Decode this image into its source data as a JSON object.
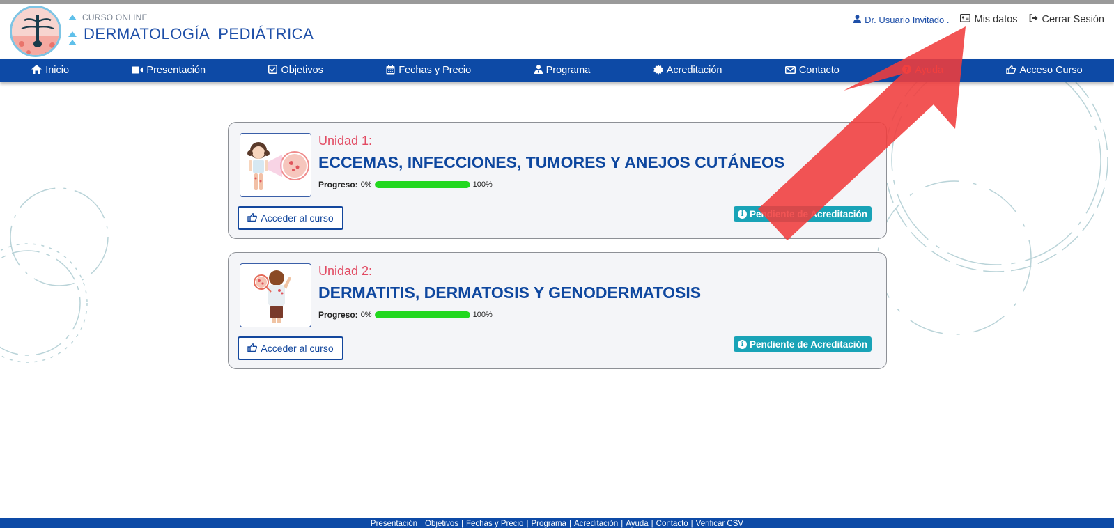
{
  "header": {
    "brand_small": "CURSO ONLINE",
    "brand_big": "DERMATOLOGÍA  PEDIÁTRICA",
    "user_name": "Dr. Usuario Invitado .",
    "my_data": "Mis datos",
    "logout": "Cerrar Sesión"
  },
  "nav": {
    "items": [
      {
        "label": "Inicio",
        "icon": "home-icon"
      },
      {
        "label": "Presentación",
        "icon": "video-icon"
      },
      {
        "label": "Objetivos",
        "icon": "check-square-icon"
      },
      {
        "label": "Fechas y Precio",
        "icon": "calendar-icon"
      },
      {
        "label": "Programa",
        "icon": "user-md-icon"
      },
      {
        "label": "Acreditación",
        "icon": "certificate-icon"
      },
      {
        "label": "Contacto",
        "icon": "envelope-icon"
      },
      {
        "label": "Ayuda",
        "icon": "question-circle-icon"
      },
      {
        "label": "Acceso Curso",
        "icon": "hand-pointer-icon"
      }
    ]
  },
  "courses": [
    {
      "unit": "Unidad 1:",
      "title": "ECCEMAS, INFECCIONES, TUMORES Y ANEJOS CUTÁNEOS",
      "progress_label": "Progreso:",
      "progress_min": "0%",
      "progress_max": "100%",
      "progress_value": 1.0,
      "access_label": "Acceder al curso",
      "status": "Pendiente de Acreditación"
    },
    {
      "unit": "Unidad 2:",
      "title": "DERMATITIS, DERMATOSIS Y GENODERMATOSIS",
      "progress_label": "Progreso:",
      "progress_min": "0%",
      "progress_max": "100%",
      "progress_value": 1.0,
      "access_label": "Acceder al curso",
      "status": "Pendiente de Acreditación"
    }
  ],
  "footer": {
    "links": [
      "Presentación",
      "Objetivos",
      "Fechas y Precio",
      "Programa",
      "Acreditación",
      "Ayuda",
      "Contacto",
      "Verificar CSV"
    ]
  },
  "colors": {
    "brand_blue": "#0d4aa6",
    "accent_red": "#e24b63",
    "progress_green": "#22d81f",
    "badge_teal": "#19a3b7",
    "arrow_red": "#f03c3c"
  }
}
